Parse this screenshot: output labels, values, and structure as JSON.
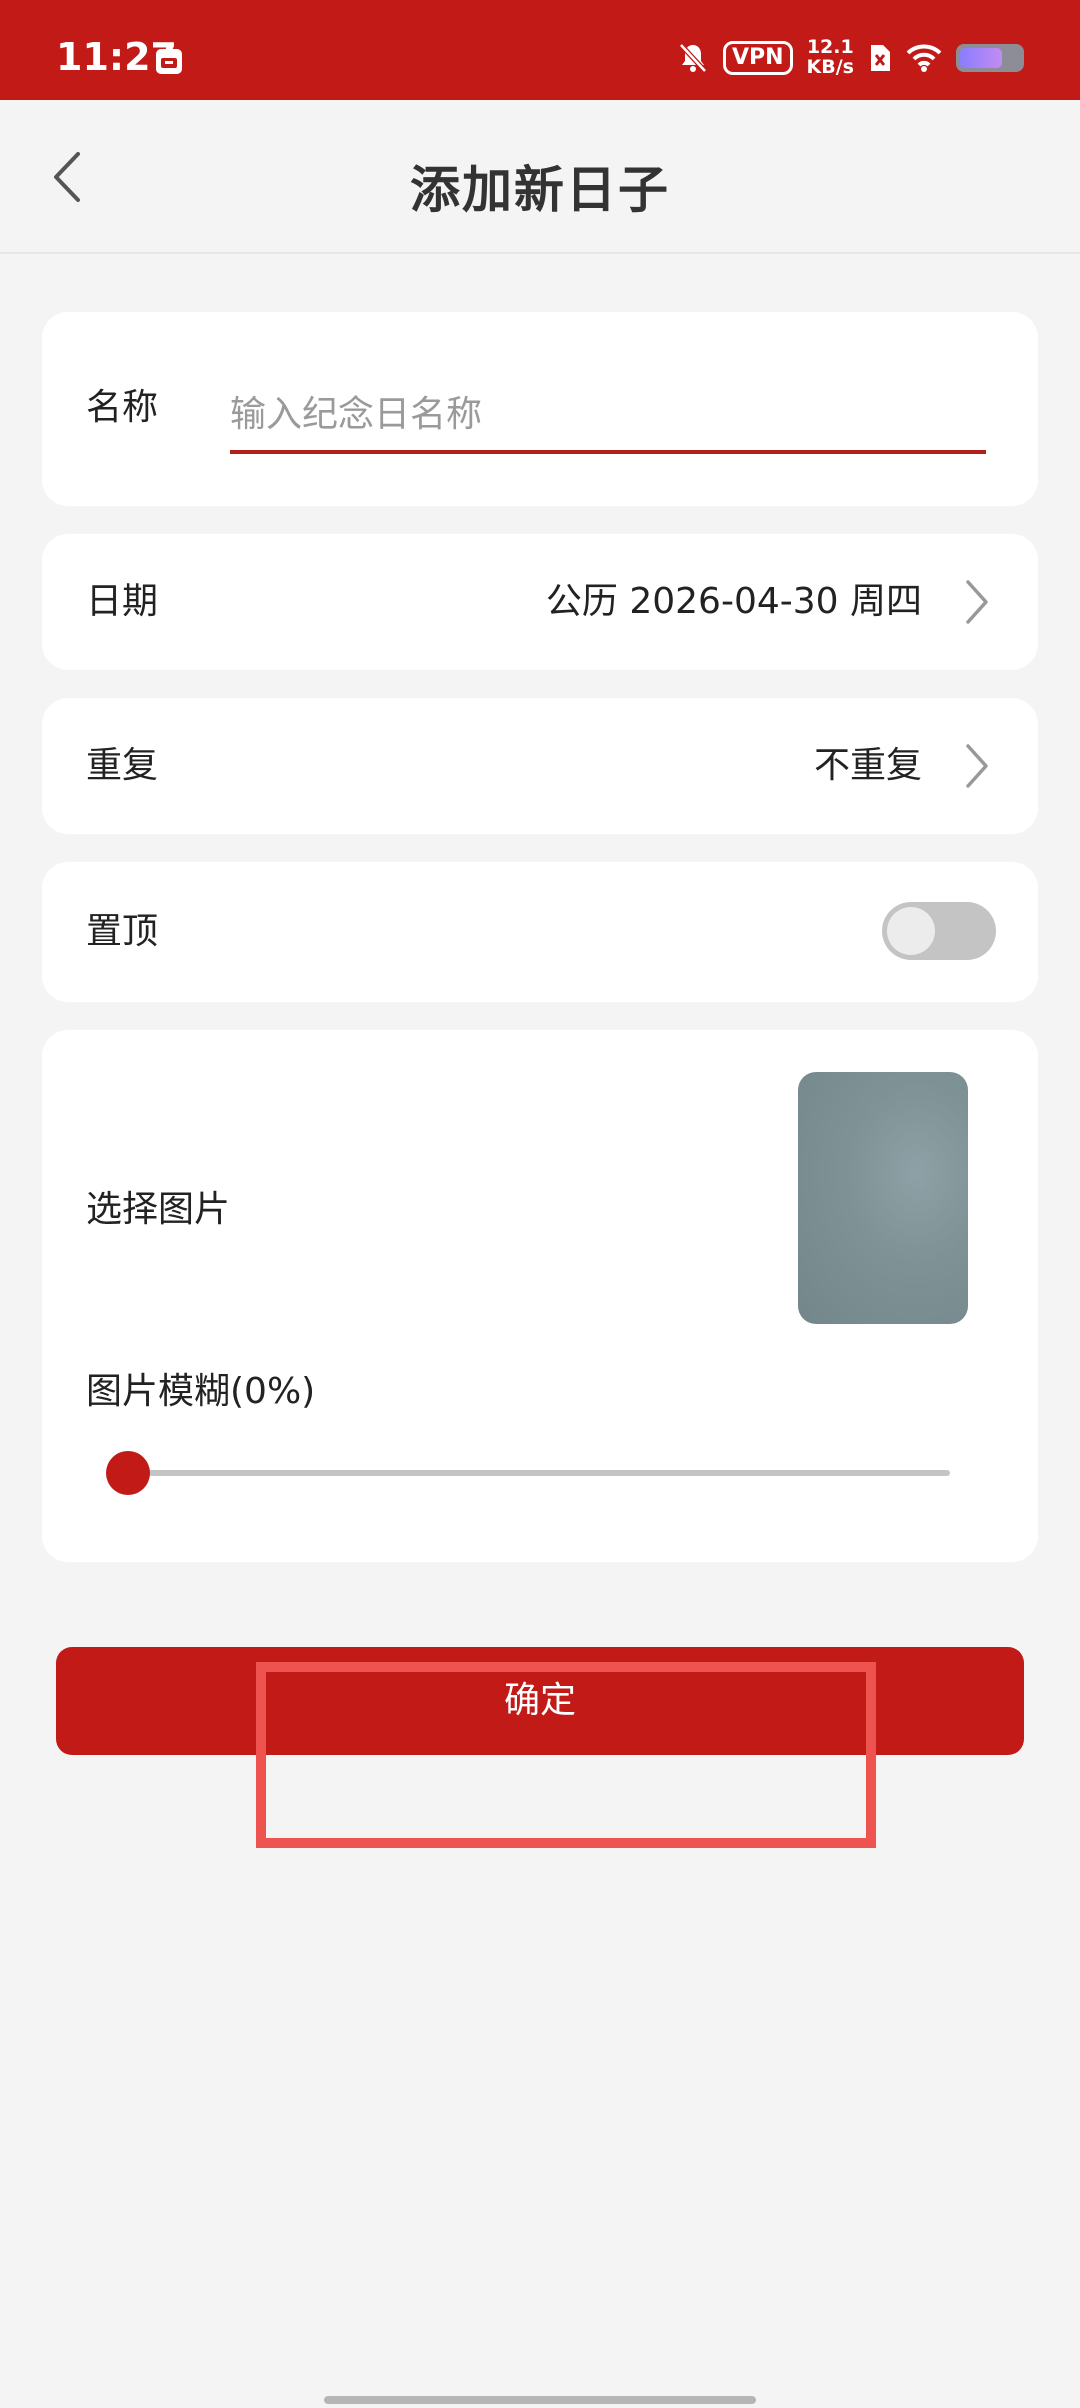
{
  "status_bar": {
    "time": "11:27",
    "vpn": "VPN",
    "speed_value": "12.1",
    "speed_unit": "KB/s",
    "battery_level": 0.7,
    "bar_color": "#c11a17"
  },
  "header": {
    "title": "添加新日子",
    "back_icon": "chevron-left-icon"
  },
  "form": {
    "name": {
      "label": "名称",
      "value": "",
      "placeholder": "输入纪念日名称"
    },
    "date": {
      "label": "日期",
      "value": "公历 2026-04-30 周四"
    },
    "repeat": {
      "label": "重复",
      "value": "不重复"
    },
    "pin": {
      "label": "置顶",
      "enabled": false
    },
    "image": {
      "label": "选择图片",
      "blur_label": "图片模糊(0%)",
      "blur_percent": 0
    }
  },
  "actions": {
    "confirm_label": "确定"
  },
  "colors": {
    "accent": "#c11a17",
    "highlight": "#ef5350"
  }
}
